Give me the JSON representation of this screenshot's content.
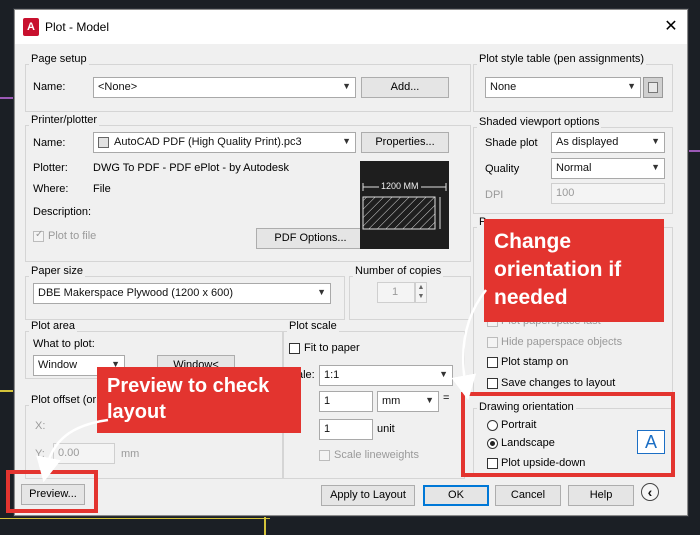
{
  "window": {
    "title": "Plot - Model",
    "app_icon_letter": "A",
    "close_glyph": "✕"
  },
  "page_setup": {
    "title": "Page setup",
    "name_label": "Name:",
    "name_value": "<None>",
    "add_button": "Add..."
  },
  "printer": {
    "title": "Printer/plotter",
    "name_label": "Name:",
    "name_value": "AutoCAD PDF (High Quality Print).pc3",
    "properties_button": "Properties...",
    "plotter_label": "Plotter:",
    "plotter_value": "DWG To PDF - PDF ePlot - by Autodesk",
    "where_label": "Where:",
    "where_value": "File",
    "description_label": "Description:",
    "plot_to_file_label": "Plot to file",
    "pdf_options_button": "PDF Options...",
    "preview_dimension": "1200 MM"
  },
  "paper_size": {
    "title": "Paper size",
    "value": "DBE Makerspace Plywood (1200 x 600)"
  },
  "copies": {
    "title": "Number of copies",
    "value": "1"
  },
  "plot_area": {
    "title": "Plot area",
    "what_label": "What to plot:",
    "what_value": "Window",
    "window_button": "Window<"
  },
  "plot_offset": {
    "title": "Plot offset (origi",
    "x_label": "X:",
    "y_label": "Y:",
    "y_value": "0.00",
    "unit": "mm"
  },
  "plot_scale": {
    "title": "Plot scale",
    "fit_label": "Fit to paper",
    "scale_label": "ale:",
    "scale_value": "1:1",
    "value1": "1",
    "unit1": "mm",
    "equals": "=",
    "value2": "1",
    "unit2": "unit",
    "lineweights_label": "Scale lineweights"
  },
  "plot_style": {
    "title": "Plot style table (pen assignments)",
    "value": "None"
  },
  "shaded": {
    "title": "Shaded viewport options",
    "shade_label": "Shade plot",
    "shade_value": "As displayed",
    "quality_label": "Quality",
    "quality_value": "Normal",
    "dpi_label": "DPI",
    "dpi_value": "100"
  },
  "plot_options": {
    "title_fragment": "P",
    "paperspace_last_label": "Plot paperspace last",
    "hide_label": "Hide paperspace objects",
    "stamp_label": "Plot stamp on",
    "save_label": "Save changes to layout"
  },
  "orientation": {
    "title": "Drawing orientation",
    "portrait": "Portrait",
    "landscape": "Landscape",
    "upside_down": "Plot upside-down",
    "icon_letter": "A"
  },
  "buttons": {
    "preview": "Preview...",
    "apply": "Apply to Layout",
    "ok": "OK",
    "cancel": "Cancel",
    "help": "Help",
    "expand_glyph": "‹"
  },
  "callouts": {
    "orientation": "Change orientation if needed",
    "preview": "Preview to check layout"
  },
  "colors": {
    "accent_red": "#e3342f",
    "dialog_bg": "#f0f0f0",
    "default_button_border": "#0078d7"
  }
}
